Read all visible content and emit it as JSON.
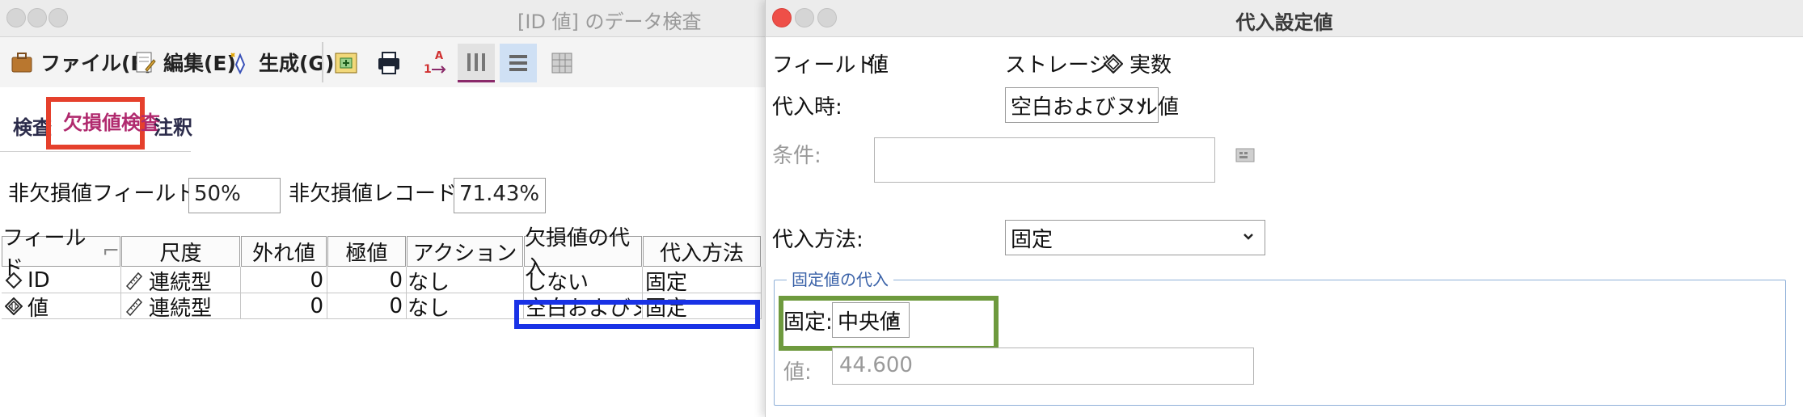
{
  "main_window": {
    "title": "[ID 値] のデータ検査",
    "menu": [
      {
        "label": "ファイル(F)",
        "icon": "briefcase-icon"
      },
      {
        "label": "編集(E)",
        "icon": "edit-document-icon"
      },
      {
        "label": "生成(G)",
        "icon": "generate-star-icon"
      }
    ],
    "toolbar_icons": [
      "add-node-icon",
      "print-icon",
      "sort-icon",
      "columns-view-icon",
      "rows-view-icon",
      "table-view-icon"
    ],
    "tabs": [
      {
        "label": "検査"
      },
      {
        "label": "欠損値検査"
      },
      {
        "label": "注釈"
      }
    ],
    "summary": {
      "fields_label": "非欠損値フィールド (%):",
      "fields_value": "50%",
      "records_label": "非欠損値レコード (%):",
      "records_value": "71.43%"
    },
    "table": {
      "headers": [
        "フィールド",
        "尺度",
        "外れ値",
        "極値",
        "アクション",
        "欠損値の代入",
        "代入方法"
      ],
      "rows": [
        {
          "field": "ID",
          "field_icon": "diamond-outline-icon",
          "scale": "連続型",
          "outliers": "0",
          "extremes": "0",
          "action": "なし",
          "impute": "しない",
          "method": "固定"
        },
        {
          "field": "値",
          "field_icon": "numeric-diamond-icon",
          "scale": "連続型",
          "outliers": "0",
          "extremes": "0",
          "action": "なし",
          "impute": "空白およびヌ...",
          "method": "固定"
        }
      ]
    }
  },
  "dialog": {
    "title": "代入設定値",
    "field_label": "フィールド:",
    "field_value": "値",
    "storage_label": "ストレージ:",
    "storage_value": "実数",
    "impute_when_label": "代入時:",
    "impute_when_value": "空白およびヌル値",
    "condition_label": "条件:",
    "method_label": "代入方法:",
    "method_value": "固定",
    "group_title": "固定値の代入",
    "fixed_label": "固定:",
    "fixed_value": "中央値",
    "value_label": "値:",
    "value_value": "44.600"
  }
}
